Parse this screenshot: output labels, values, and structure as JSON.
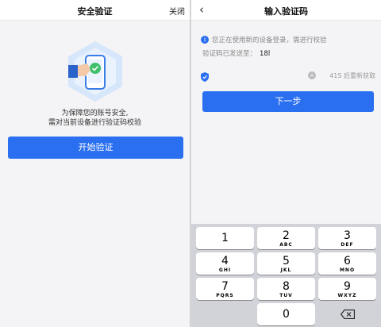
{
  "left_screen": {
    "title": "安全验证",
    "close_label": "关闭",
    "description_line1": "为保障您的账号安全,",
    "description_line2": "需对当前设备进行验证码校验",
    "start_button": "开始验证"
  },
  "right_screen": {
    "title": "输入验证码",
    "back_icon": "chevron-left-icon",
    "info_text": "您正在使用新的设备登录，需进行校验",
    "sent_label": "验证码已发送至：",
    "phone": "18l",
    "code_value": "",
    "resend_label": "41S 后重新获取",
    "next_button": "下一步"
  },
  "keypad": {
    "keys": [
      {
        "num": "1",
        "letters": ""
      },
      {
        "num": "2",
        "letters": "ABC"
      },
      {
        "num": "3",
        "letters": "DEF"
      },
      {
        "num": "4",
        "letters": "GHI"
      },
      {
        "num": "5",
        "letters": "JKL"
      },
      {
        "num": "6",
        "letters": "MNO"
      },
      {
        "num": "7",
        "letters": "PQRS"
      },
      {
        "num": "8",
        "letters": "TUV"
      },
      {
        "num": "9",
        "letters": "WXYZ"
      },
      {
        "num": "0",
        "letters": ""
      }
    ],
    "delete_icon": "backspace-icon"
  },
  "colors": {
    "primary": "#2a6ff0",
    "background": "#f4f4f6",
    "keypad_bg": "#d1d3d9"
  }
}
